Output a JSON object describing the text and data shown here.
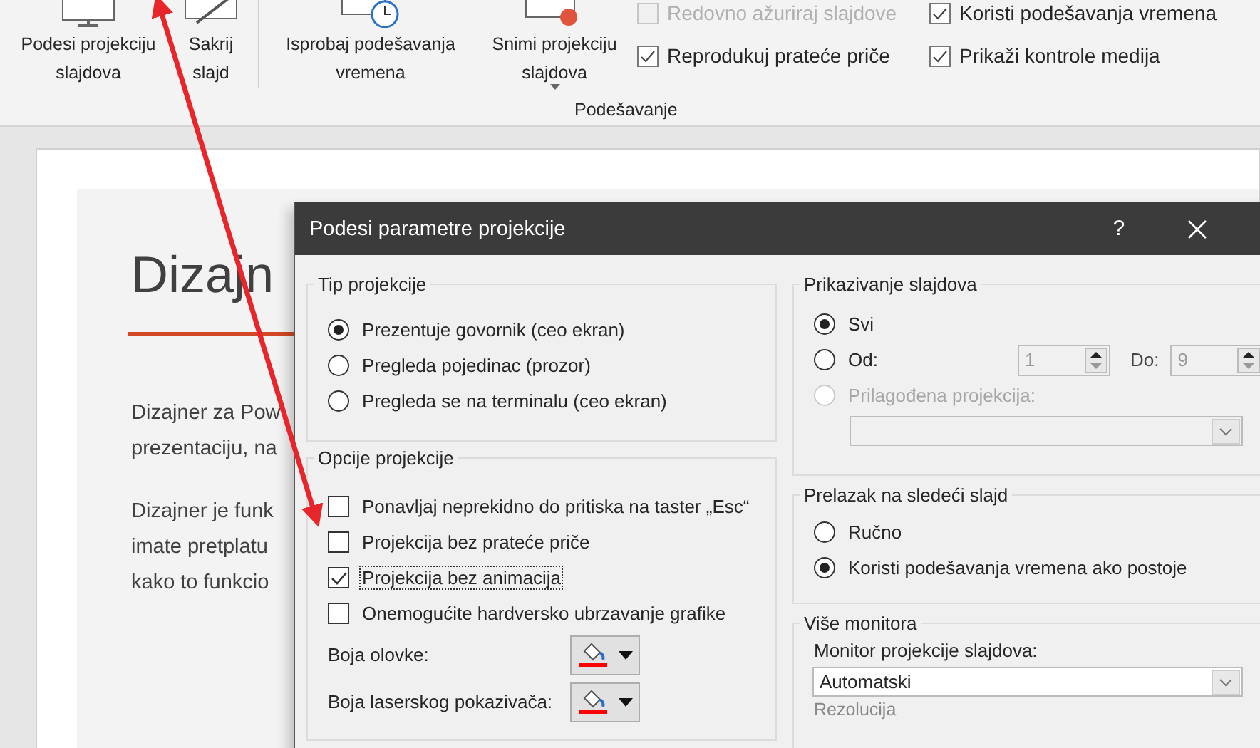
{
  "ribbon": {
    "buttons": [
      {
        "kind": "setup",
        "lines": [
          "Podesi projekciju",
          "slajdova"
        ],
        "dropdown": false
      },
      {
        "kind": "hide",
        "lines": [
          "Sakrij",
          "slajd"
        ],
        "dropdown": false
      },
      {
        "kind": "rehearse",
        "lines": [
          "Isprobaj podešavanja",
          "vremena"
        ],
        "dropdown": false
      },
      {
        "kind": "record",
        "lines": [
          "Snimi projekciju",
          "slajdova"
        ],
        "dropdown": true
      }
    ],
    "checkbox_columns": [
      [
        {
          "label": "Redovno ažuriraj slajdove",
          "checked": false,
          "disabled": true
        },
        {
          "label": "Reprodukuj prateće priče",
          "checked": true,
          "disabled": false
        }
      ],
      [
        {
          "label": "Koristi podešavanja vremena",
          "checked": true,
          "disabled": false
        },
        {
          "label": "Prikaži kontrole medija",
          "checked": true,
          "disabled": false
        }
      ]
    ],
    "group_label": "Podešavanje"
  },
  "slide": {
    "title": "Dizajn",
    "paragraphs": [
      [
        "Dizajner za Pow",
        "prezentaciju, na"
      ],
      [
        "Dizajner je funk",
        "imate pretplatu",
        "kako to funkcio"
      ]
    ]
  },
  "dialog": {
    "title": "Podesi parametre projekcije",
    "help": "?",
    "show_type": {
      "legend": "Tip projekcije",
      "options": [
        {
          "label": "Prezentuje govornik (ceo ekran)",
          "selected": true
        },
        {
          "label": "Pregleda pojedinac (prozor)",
          "selected": false
        },
        {
          "label": "Pregleda se na terminalu (ceo ekran)",
          "selected": false
        }
      ]
    },
    "show_options": {
      "legend": "Opcije projekcije",
      "checkboxes": [
        {
          "label": "Ponavljaj neprekidno do pritiska na taster „Esc“",
          "checked": false,
          "focused": false
        },
        {
          "label": "Projekcija bez prateće priče",
          "checked": false,
          "focused": false
        },
        {
          "label": "Projekcija bez animacija",
          "checked": true,
          "focused": true
        },
        {
          "label": "Onemogućite hardversko ubrzavanje grafike",
          "checked": false,
          "focused": false
        }
      ],
      "colors": [
        {
          "label": "Boja olovke:",
          "color": "#ff0000"
        },
        {
          "label": "Boja laserskog pokazivača:",
          "color": "#ff0000"
        }
      ]
    },
    "show_slides": {
      "legend": "Prikazivanje slajdova",
      "options": [
        {
          "kind": "all",
          "label": "Svi",
          "selected": true,
          "disabled": false
        },
        {
          "kind": "range",
          "label": "Od:",
          "selected": false,
          "disabled": false
        },
        {
          "kind": "custom",
          "label": "Prilagođena projekcija:",
          "selected": false,
          "disabled": true
        }
      ],
      "from": "1",
      "to_label": "Do:",
      "to": "9"
    },
    "advance": {
      "legend": "Prelazak na sledeći slajd",
      "options": [
        {
          "label": "Ručno",
          "selected": false
        },
        {
          "label": "Koristi podešavanja vremena ako postoje",
          "selected": true
        }
      ]
    },
    "monitors": {
      "legend": "Više monitora",
      "monitor_label": "Monitor projekcije slajdova:",
      "monitor_value": "Automatski",
      "resolution_label": "Rezolucija"
    }
  }
}
